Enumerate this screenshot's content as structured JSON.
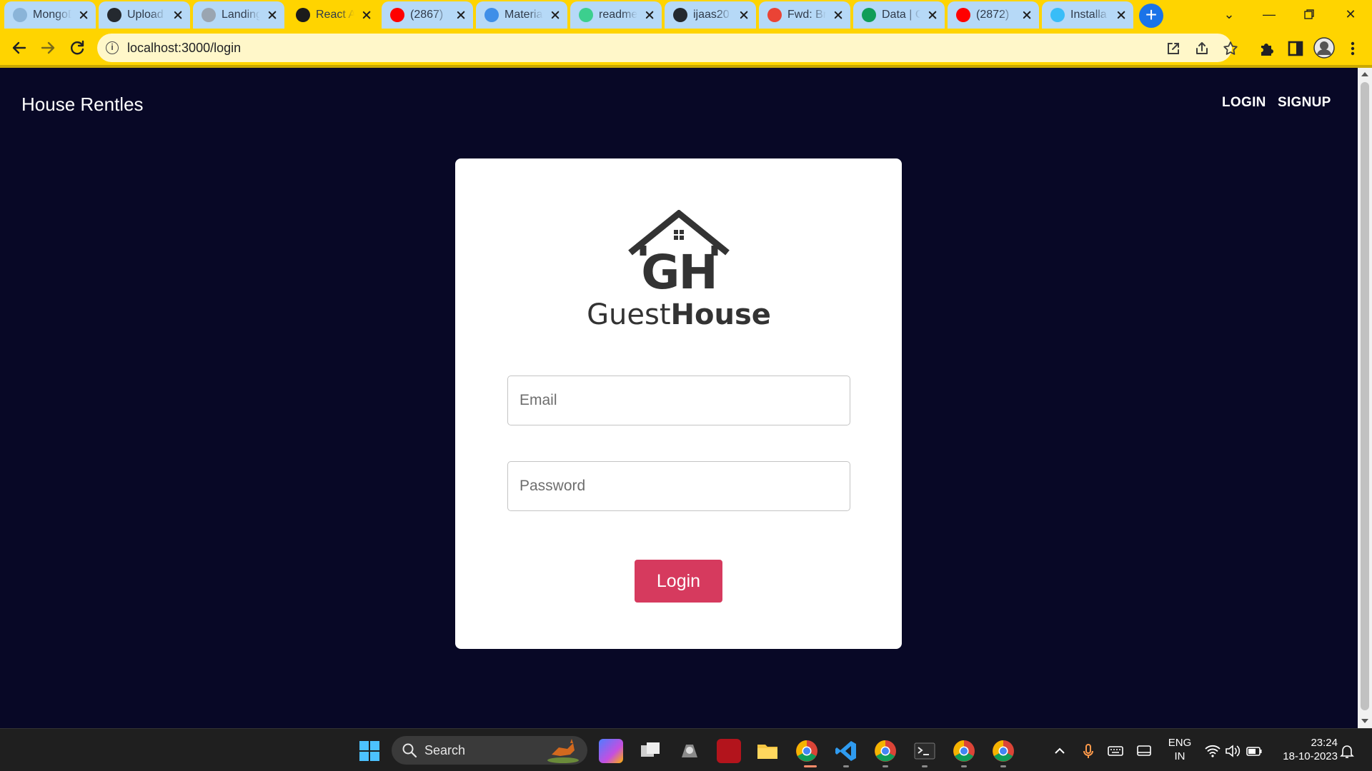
{
  "browser": {
    "tabs": [
      {
        "title": "MongoDB",
        "favicon": "mongodb-icon",
        "color": "#8ab4d8"
      },
      {
        "title": "Upload",
        "favicon": "github-icon",
        "color": "#24292f"
      },
      {
        "title": "Landing",
        "favicon": "globe-icon",
        "color": "#9aa5b1"
      },
      {
        "title": "React App",
        "favicon": "react-icon",
        "color": "#1b1b1b",
        "active": true
      },
      {
        "title": "(2867)",
        "favicon": "youtube-icon",
        "color": "#ff0000"
      },
      {
        "title": "Material",
        "favicon": "material-icon",
        "color": "#3f8fe8"
      },
      {
        "title": "readme",
        "favicon": "readme-icon",
        "color": "#3ccf8e"
      },
      {
        "title": "ijaas20",
        "favicon": "github-icon",
        "color": "#24292f"
      },
      {
        "title": "Fwd: Br",
        "favicon": "gmail-icon",
        "color": "#ea4335"
      },
      {
        "title": "Data | C",
        "favicon": "mongodb-leaf-icon",
        "color": "#0f9d58"
      },
      {
        "title": "(2872)",
        "favicon": "youtube-icon",
        "color": "#ff0000"
      },
      {
        "title": "Installa",
        "favicon": "tailwind-icon",
        "color": "#38bdf8"
      }
    ],
    "url": "localhost:3000/login"
  },
  "page": {
    "brand": "House Rentles",
    "nav": {
      "login": "LOGIN",
      "signup": "SIGNUP"
    },
    "logo": {
      "monogram": "GH",
      "word_regular": "Guest",
      "word_bold": "House"
    },
    "form": {
      "email_placeholder": "Email",
      "password_placeholder": "Password",
      "submit_label": "Login"
    },
    "colors": {
      "background": "#080826",
      "card": "#ffffff",
      "button": "#d63a5e",
      "chrome": "#ffd400"
    }
  },
  "taskbar": {
    "search_label": "Search",
    "language": "ENG",
    "region": "IN",
    "time": "23:24",
    "date": "18-10-2023"
  }
}
